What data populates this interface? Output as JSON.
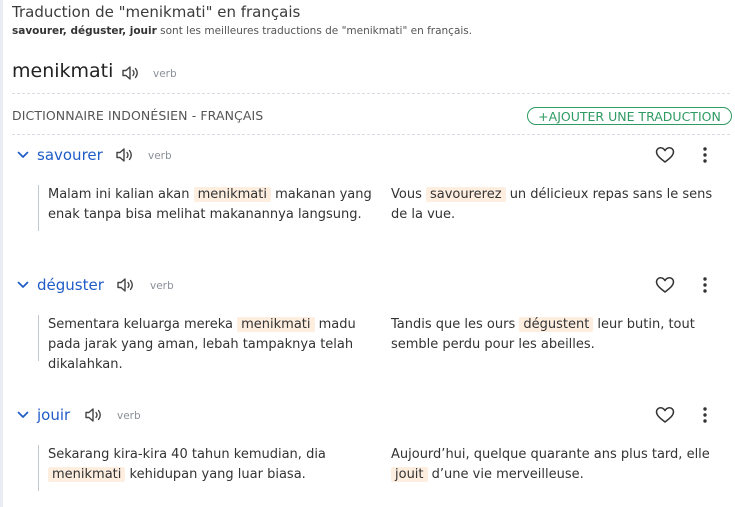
{
  "header": {
    "title": "Traduction de \"menikmati\" en français",
    "subtitle_words": "savourer, déguster, jouir",
    "subtitle_rest": " sont les meilleures traductions de \"menikmati\" en français."
  },
  "headword": {
    "word": "menikmati",
    "pos": "verb"
  },
  "section": {
    "title": "DICTIONNAIRE INDONÉSIEN - FRANÇAIS",
    "add_button": "+AJOUTER UNE TRADUCTION"
  },
  "translations": [
    {
      "word": "savourer",
      "pos": "verb",
      "src_pre": "Malam ini kalian akan ",
      "src_hl": "menikmati",
      "src_post": " makanan yang enak tanpa bisa melihat makanannya langsung.",
      "tgt_pre": "Vous ",
      "tgt_hl": "savourerez",
      "tgt_post": " un délicieux repas sans le sens de la vue."
    },
    {
      "word": "déguster",
      "pos": "verb",
      "src_pre": "Sementara keluarga mereka ",
      "src_hl": "menikmati",
      "src_post": " madu pada jarak yang aman, lebah tampaknya telah dikalahkan.",
      "tgt_pre": "Tandis que les ours ",
      "tgt_hl": "dégustent",
      "tgt_post": " leur butin, tout semble perdu pour les abeilles."
    },
    {
      "word": "jouir",
      "pos": "verb",
      "src_pre": "Sekarang kira-kira 40 tahun kemudian, dia ",
      "src_hl": "menikmati",
      "src_post": " kehidupan yang luar biasa.",
      "tgt_pre": "Aujourd’hui, quelque quarante ans plus tard, elle ",
      "tgt_hl": "jouit",
      "tgt_post": " d’une vie merveilleuse."
    }
  ],
  "icons": {
    "speaker": "speaker-icon",
    "chevron": "chevron-down-icon",
    "heart": "heart-icon",
    "more": "more-vertical-icon"
  },
  "colors": {
    "accent_blue": "#1f5cc7",
    "accent_green": "#2e9b63",
    "highlight": "#fdeee0"
  }
}
